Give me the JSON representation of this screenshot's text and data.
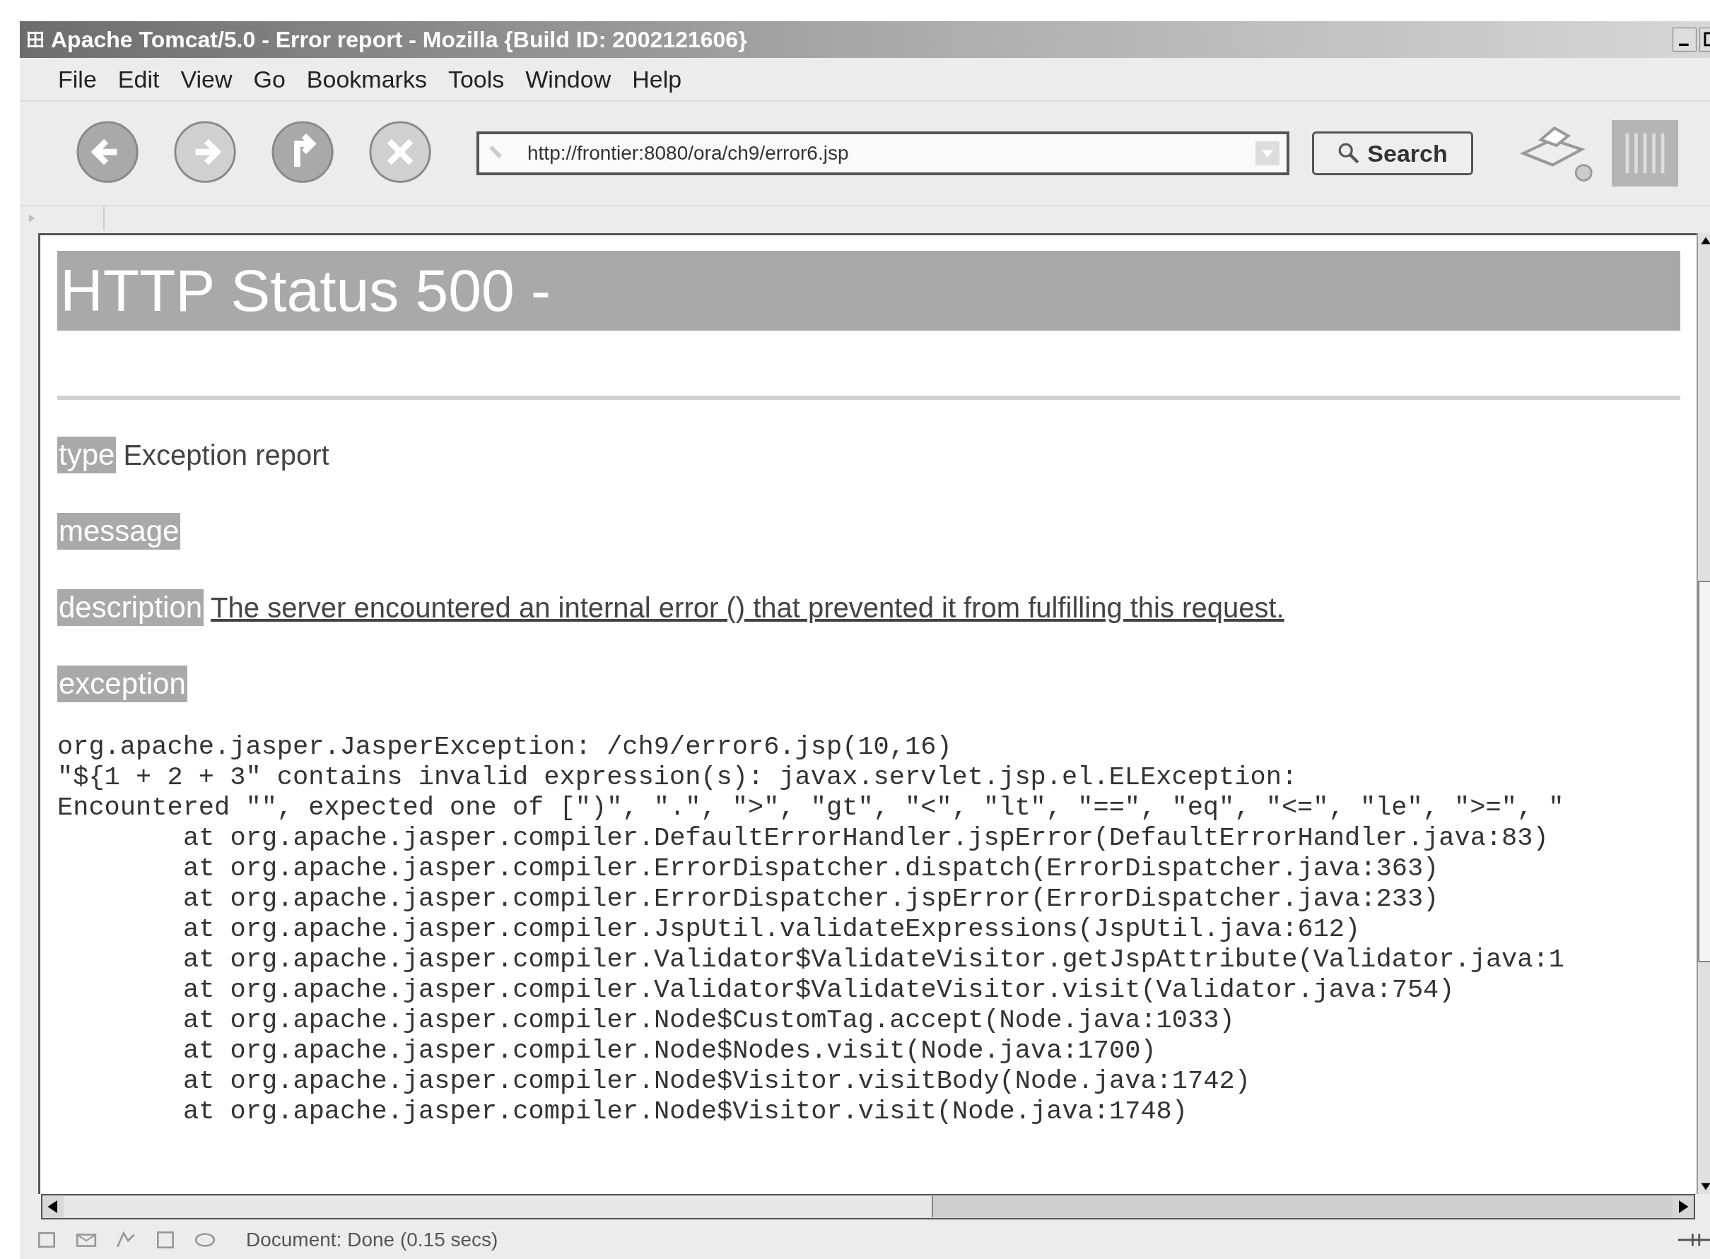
{
  "window": {
    "title": "Apache Tomcat/5.0 - Error report - Mozilla {Build ID: 2002121606}"
  },
  "menu": [
    "File",
    "Edit",
    "View",
    "Go",
    "Bookmarks",
    "Tools",
    "Window",
    "Help"
  ],
  "toolbar": {
    "nav_buttons": [
      {
        "kind": "back",
        "disabled": false
      },
      {
        "kind": "forward",
        "disabled": true
      },
      {
        "kind": "reload",
        "disabled": false
      },
      {
        "kind": "stop",
        "disabled": true
      }
    ],
    "url": "http://frontier:8080/ora/ch9/error6.jsp",
    "search_label": "Search"
  },
  "page": {
    "heading": "HTTP Status 500 -",
    "fields": [
      {
        "label": "type",
        "text": "Exception report",
        "underlined": false
      },
      {
        "label": "message"
      },
      {
        "label": "description",
        "text": "The server encountered an internal error () that prevented it from fulfilling this request.",
        "underlined": true
      },
      {
        "label": "exception"
      }
    ],
    "exception_lines": [
      {
        "kind": "cause",
        "text": "org.apache.jasper.JasperException: /ch9/error6.jsp(10,16)"
      },
      {
        "kind": "cause",
        "text": "\"${1 + 2 + 3\" contains invalid expression(s): javax.servlet.jsp.el.ELException:"
      },
      {
        "kind": "cause",
        "text": "Encountered \"\", expected one of [\")\", \".\", \">\", \"gt\", \"<\", \"lt\", \"==\", \"eq\", \"<=\", \"le\", \">=\", \""
      },
      {
        "kind": "frame",
        "text": "at org.apache.jasper.compiler.DefaultErrorHandler.jspError(DefaultErrorHandler.java:83)"
      },
      {
        "kind": "frame",
        "text": "at org.apache.jasper.compiler.ErrorDispatcher.dispatch(ErrorDispatcher.java:363)"
      },
      {
        "kind": "frame",
        "text": "at org.apache.jasper.compiler.ErrorDispatcher.jspError(ErrorDispatcher.java:233)"
      },
      {
        "kind": "frame",
        "text": "at org.apache.jasper.compiler.JspUtil.validateExpressions(JspUtil.java:612)"
      },
      {
        "kind": "frame",
        "text": "at org.apache.jasper.compiler.Validator$ValidateVisitor.getJspAttribute(Validator.java:1"
      },
      {
        "kind": "frame",
        "text": "at org.apache.jasper.compiler.Validator$ValidateVisitor.visit(Validator.java:754)"
      },
      {
        "kind": "frame",
        "text": "at org.apache.jasper.compiler.Node$CustomTag.accept(Node.java:1033)"
      },
      {
        "kind": "frame",
        "text": "at org.apache.jasper.compiler.Node$Nodes.visit(Node.java:1700)"
      },
      {
        "kind": "frame",
        "text": "at org.apache.jasper.compiler.Node$Visitor.visitBody(Node.java:1742)"
      },
      {
        "kind": "frame",
        "text": "at org.apache.jasper.compiler.Node$Visitor.visit(Node.java:1748)"
      }
    ]
  },
  "status_bar": {
    "text": "Document: Done (0.15 secs)"
  }
}
